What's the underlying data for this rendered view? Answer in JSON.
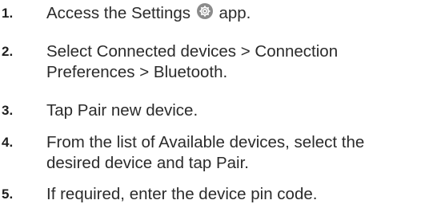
{
  "steps": [
    {
      "number": "1.",
      "text_before_icon": "Access the Settings",
      "icon": "settings-gear-icon",
      "text_after_icon": "app."
    },
    {
      "number": "2.",
      "line1": "Select Connected devices > Connection",
      "line2": "Preferences > Bluetooth."
    },
    {
      "number": "3.",
      "line1": "Tap Pair new device."
    },
    {
      "number": "4.",
      "line1": "From the list of Available devices, select the",
      "line2": "desired device and tap Pair."
    },
    {
      "number": "5.",
      "line1": "If required, enter the device pin code."
    }
  ],
  "colors": {
    "text": "#2b2b2b",
    "number": "#1e1e1e",
    "icon_bg": "#8b8b8b"
  }
}
